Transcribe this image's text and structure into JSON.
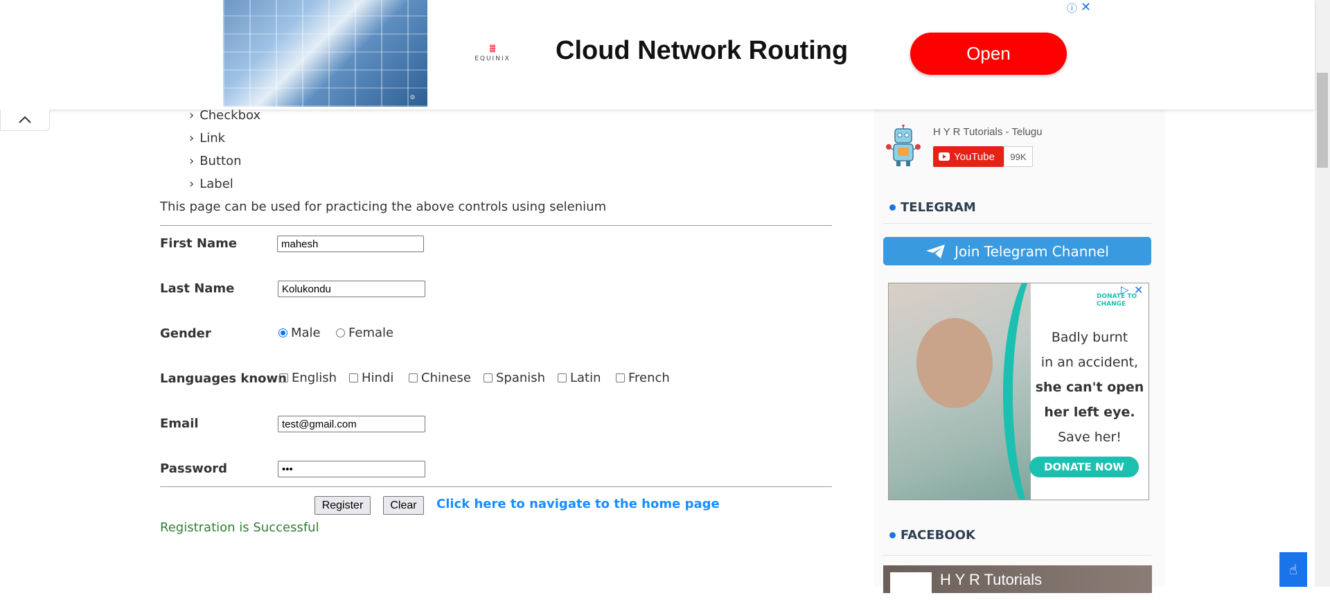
{
  "top_ad": {
    "brand": "EQUINIX",
    "headline": "Cloud Network Routing",
    "cta": "Open"
  },
  "controls_list": [
    "Checkbox",
    "Link",
    "Button",
    "Label"
  ],
  "description": "This page can be used for practicing the above controls using selenium",
  "form": {
    "first_name": {
      "label": "First Name",
      "value": "mahesh"
    },
    "last_name": {
      "label": "Last Name",
      "value": "Kolukondu"
    },
    "gender": {
      "label": "Gender",
      "options": [
        "Male",
        "Female"
      ],
      "selected": "Male"
    },
    "languages": {
      "label": "Languages known",
      "options": [
        "English",
        "Hindi",
        "Chinese",
        "Spanish",
        "Latin",
        "French"
      ]
    },
    "email": {
      "label": "Email",
      "value": "test@gmail.com"
    },
    "password": {
      "label": "Password",
      "value": "•••"
    },
    "register_label": "Register",
    "clear_label": "Clear",
    "home_link": "Click here to navigate to the home page",
    "success_message": "Registration is Successful"
  },
  "sidebar": {
    "youtube_channel": "H Y R Tutorials - Telugu",
    "youtube_button": "YouTube",
    "youtube_count": "99K",
    "telegram_heading": "TELEGRAM",
    "telegram_button": "Join Telegram Channel",
    "side_ad": {
      "brand_line1": "DONATE TO",
      "brand_line2": "CHANGE",
      "line1": "Badly burnt",
      "line2": "in an accident,",
      "line3": "she can't open",
      "line4": "her left eye.",
      "line5": "Save her!",
      "cta": "DONATE NOW"
    },
    "facebook_heading": "FACEBOOK",
    "facebook_page_name": "H Y R Tutorials"
  },
  "colors": {
    "link_blue": "#1a8cff",
    "success_green": "#2e7d32",
    "telegram_blue": "#3a9ae0",
    "ad_red": "#ff0000",
    "donate_teal": "#1cc0b0"
  }
}
